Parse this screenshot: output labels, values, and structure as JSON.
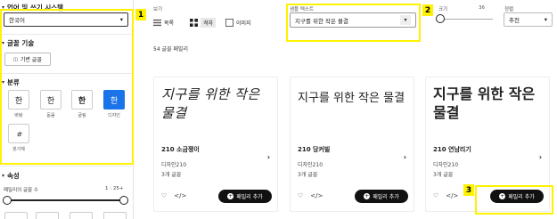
{
  "sidebar": {
    "section_language": "언어 및 쓰기 시스템",
    "language_value": "한국어",
    "section_technology": "글꼴 기술",
    "technology_button": "기변 글꼴",
    "section_classification": "분류",
    "classifications": [
      {
        "glyph": "한",
        "label": "바탕"
      },
      {
        "glyph": "한",
        "label": "돋움"
      },
      {
        "glyph": "한",
        "label": "굴림"
      },
      {
        "glyph": "한",
        "label": "디자인"
      },
      {
        "glyph": "ㅎ",
        "label": "붓기체"
      }
    ],
    "section_properties": "속성",
    "property_label": "패밀리의 글꼴 수",
    "property_value": "1 : 25+"
  },
  "toolbar": {
    "view_label": "보기",
    "view_list": "목록",
    "view_grid": "격자",
    "view_image": "이미지",
    "sample_label": "샘플 텍스트",
    "sample_value": "지구를 위한 작은 물결",
    "size_label": "크기",
    "size_value": "36",
    "sort_label": "정렬",
    "sort_value": "추천"
  },
  "results": {
    "count_text": "54 글꼴 패밀리"
  },
  "cards": [
    {
      "preview": "지구를 위한 작은 물결",
      "name": "210 소금쟁이",
      "maker": "디자인210",
      "count": "3개 글꼴",
      "add": "패밀리 추가"
    },
    {
      "preview": "지구를 위한 작은 물결",
      "name": "210 당커빌",
      "maker": "디자인210",
      "count": "3개 글꼴",
      "add": "패밀리 추가"
    },
    {
      "preview": "지구를 위한 작은 물결",
      "name": "210 연남리기",
      "maker": "디자인210",
      "count": "3개 글꼴",
      "add": "패밀리 추가"
    }
  ],
  "annotations": [
    "1",
    "2",
    "3"
  ],
  "colors": {
    "highlight": "#fff200",
    "accent": "#1a73e8",
    "button": "#111111"
  }
}
